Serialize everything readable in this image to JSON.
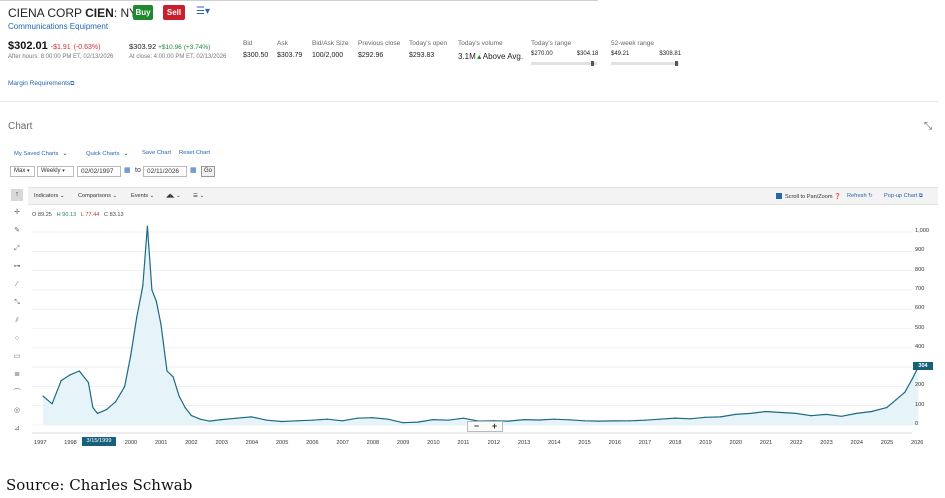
{
  "quote": {
    "company_prefix": "CIENA CORP ",
    "ticker": "CIEN",
    "exchange": ": NYSE",
    "buy_label": "Buy",
    "sell_label": "Sell",
    "sector": "Communications Equipment",
    "last_price": "$302.01",
    "last_change": "-$1.91",
    "last_change_pct": "(-0.63%)",
    "after_hours": "After hours: 8:00:00 PM ET, 02/13/2026",
    "close_price": "$303.92",
    "close_change": "+$10.96",
    "close_change_pct": "(+3.74%)",
    "at_close": "At close: 4:00:00 PM ET, 02/13/2026",
    "bid_label": "Bid",
    "bid": "$300.50",
    "ask_label": "Ask",
    "ask": "$303.79",
    "bidask_size_label": "Bid/Ask Size",
    "bidask_size": "100/2,000",
    "prev_close_label": "Previous close",
    "prev_close": "$292.96",
    "open_label": "Today's open",
    "open": "$293.83",
    "volume_label": "Today's volume",
    "volume": "3.1M",
    "volume_note": "Above Avg.",
    "day_range_label": "Today's range",
    "day_low": "$270.00",
    "day_high": "$304.18",
    "day_range_position": 0.96,
    "wk52_label": "52-week range",
    "wk52_low": "$49.21",
    "wk52_high": "$308.81",
    "wk52_position": 0.98,
    "margin_link": "Margin Requirements"
  },
  "chart_panel": {
    "title": "Chart",
    "my_saved": "My Saved Charts",
    "quick": "Quick Charts",
    "save": "Save Chart",
    "reset": "Reset Chart",
    "range_value": "Max",
    "interval_value": "Weekly",
    "date_from": "02/02/1997",
    "to_label": "to",
    "date_to": "02/11/2026",
    "go_label": "Go",
    "indicators": "Indicators",
    "comparisons": "Comparisons",
    "events": "Events",
    "scroll_label": "Scroll to Pan/Zoom",
    "refresh": "Refresh",
    "popup": "Pop-up Chart",
    "ohlc": {
      "o_label": "O",
      "o": "89.25",
      "h_label": "H",
      "h": "90.13",
      "l_label": "L",
      "l": "77.44",
      "c_label": "C",
      "c": "83.13"
    },
    "price_flag": "304",
    "date_flag": "3/15/1999"
  },
  "colors": {
    "line": "#1b6b85",
    "fill": "#e6f3f8",
    "flag": "#17607a"
  },
  "chart_data": {
    "type": "area",
    "x_ticks": [
      "1997",
      "1998",
      "1999",
      "2000",
      "2001",
      "2002",
      "2003",
      "2004",
      "2005",
      "2006",
      "2007",
      "2008",
      "2009",
      "2010",
      "2011",
      "2012",
      "2013",
      "2014",
      "2015",
      "2016",
      "2017",
      "2018",
      "2019",
      "2020",
      "2021",
      "2022",
      "2023",
      "2024",
      "2025",
      "2026"
    ],
    "y_ticks": [
      0,
      100,
      200,
      300,
      400,
      500,
      600,
      700,
      800,
      900,
      1000
    ],
    "y_tick_labels": [
      "0",
      "100",
      "200",
      "300",
      "400",
      "500",
      "600",
      "700",
      "800",
      "900",
      "1,000"
    ],
    "ylim": [
      0,
      1000
    ],
    "x": [
      1997.1,
      1997.4,
      1997.7,
      1998.0,
      1998.3,
      1998.6,
      1998.75,
      1998.9,
      1999.2,
      1999.5,
      1999.8,
      2000.0,
      2000.2,
      2000.4,
      2000.55,
      2000.7,
      2000.85,
      2001.0,
      2001.2,
      2001.4,
      2001.6,
      2001.8,
      2002.0,
      2002.3,
      2002.6,
      2003.0,
      2003.5,
      2004.0,
      2004.5,
      2005.0,
      2005.5,
      2006.0,
      2006.5,
      2007.0,
      2007.5,
      2008.0,
      2008.5,
      2009.0,
      2009.5,
      2010.0,
      2010.5,
      2011.0,
      2011.5,
      2012.0,
      2012.5,
      2013.0,
      2013.5,
      2014.0,
      2014.5,
      2015.0,
      2015.5,
      2016.0,
      2016.5,
      2017.0,
      2017.5,
      2018.0,
      2018.5,
      2019.0,
      2019.5,
      2020.0,
      2020.5,
      2021.0,
      2021.5,
      2022.0,
      2022.5,
      2023.0,
      2023.5,
      2024.0,
      2024.5,
      2025.0,
      2025.3,
      2025.6,
      2025.85,
      2026.05
    ],
    "y": [
      150,
      110,
      230,
      260,
      280,
      220,
      90,
      60,
      80,
      120,
      200,
      360,
      560,
      720,
      1030,
      700,
      640,
      520,
      280,
      250,
      150,
      90,
      50,
      30,
      20,
      28,
      35,
      42,
      25,
      18,
      22,
      25,
      30,
      22,
      35,
      38,
      30,
      12,
      15,
      28,
      25,
      35,
      20,
      22,
      20,
      28,
      26,
      30,
      27,
      22,
      20,
      21,
      22,
      25,
      30,
      36,
      32,
      40,
      42,
      55,
      60,
      70,
      65,
      60,
      48,
      55,
      45,
      60,
      70,
      90,
      130,
      170,
      240,
      304
    ]
  },
  "source": "Source:  Charles Schwab"
}
